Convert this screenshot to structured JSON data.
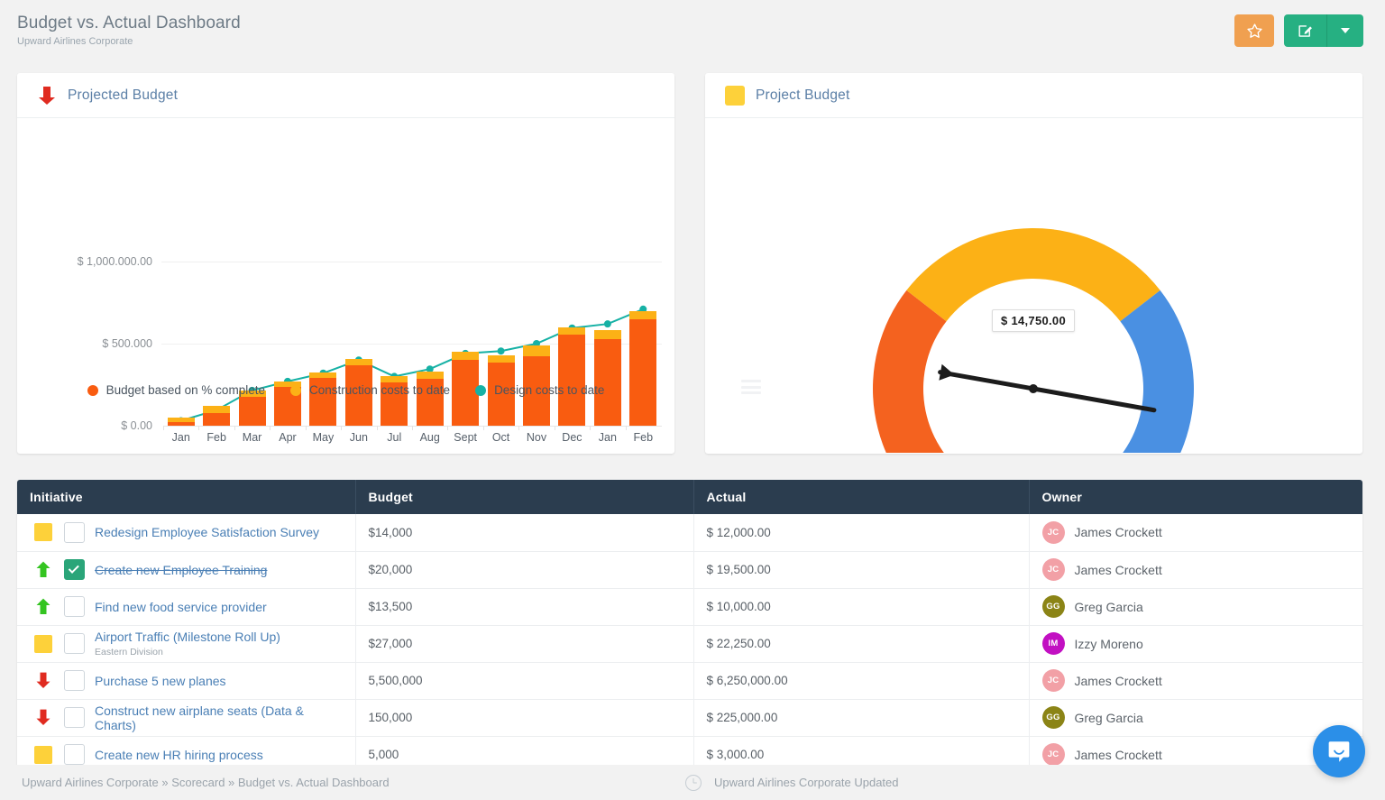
{
  "header": {
    "title": "Budget vs. Actual Dashboard",
    "subtitle": "Upward Airlines Corporate",
    "star_label": "",
    "edit_label": "",
    "caret_label": ""
  },
  "chart_panel": {
    "title": "Projected Budget",
    "icon": "arrow-down-red-icon"
  },
  "gauge_panel": {
    "title": "Project Budget",
    "icon": "square-yellow-icon",
    "value_label": "$ 14,750.00"
  },
  "chart_data": {
    "type": "bar",
    "title": "Projected Budget",
    "xlabel": "",
    "ylabel": "",
    "ylim": [
      0,
      1000000
    ],
    "ytick_labels": [
      "$ 1,000.000.00",
      "$ 500.000",
      "$ 0.00"
    ],
    "ytick_values": [
      1000000,
      500000,
      0
    ],
    "grid": true,
    "legend_position": "bottom",
    "categories": [
      "Jan",
      "Feb",
      "Mar",
      "Apr",
      "May",
      "Jun",
      "Jul",
      "Aug",
      "Sept",
      "Oct",
      "Nov",
      "Dec",
      "Jan",
      "Feb"
    ],
    "series": [
      {
        "name": "Budget based on % complete",
        "color": "#f95c10",
        "values": [
          20000,
          75000,
          175000,
          235000,
          290000,
          370000,
          265000,
          285000,
          400000,
          385000,
          425000,
          555000,
          530000,
          650000
        ]
      },
      {
        "name": "Construction costs to date",
        "color": "#fcb116",
        "values": [
          30000,
          45000,
          40000,
          35000,
          35000,
          35000,
          35000,
          45000,
          50000,
          45000,
          65000,
          45000,
          50000,
          50000
        ]
      },
      {
        "name": "Design costs to date",
        "color": "#16b1a5",
        "type": "line",
        "values": [
          30000,
          95000,
          215000,
          270000,
          320000,
          400000,
          300000,
          345000,
          440000,
          455000,
          500000,
          595000,
          620000,
          710000
        ]
      }
    ]
  },
  "gauge_data": {
    "type": "gauge",
    "value_label": "$ 14,750.00",
    "segments": [
      {
        "name": "low",
        "color": "#f4621f",
        "share": 0.32
      },
      {
        "name": "mid",
        "color": "#fcb116",
        "share": 0.36
      },
      {
        "name": "high",
        "color": "#4a90e2",
        "share": 0.32
      }
    ],
    "needle_color": "#1c1c1c"
  },
  "table": {
    "columns": [
      "Initiative",
      "Budget",
      "Actual",
      "Owner"
    ],
    "rows": [
      {
        "status": "square-yellow",
        "checked": false,
        "done": false,
        "name": "Redesign Employee Satisfaction Survey",
        "sub": "",
        "budget": "$14,000",
        "actual": "$ 12,000.00",
        "owner": "James Crockett",
        "initials": "JC",
        "avatar_color": "#f2a0a6"
      },
      {
        "status": "arrow-up-green",
        "checked": true,
        "done": true,
        "name": "Create new Employee Training",
        "sub": "",
        "budget": "$20,000",
        "actual": "$ 19,500.00",
        "owner": "James Crockett",
        "initials": "JC",
        "avatar_color": "#f2a0a6"
      },
      {
        "status": "arrow-up-green",
        "checked": false,
        "done": false,
        "name": "Find new food service provider",
        "sub": "",
        "budget": "$13,500",
        "actual": "$ 10,000.00",
        "owner": "Greg Garcia",
        "initials": "GG",
        "avatar_color": "#8b8416"
      },
      {
        "status": "square-yellow",
        "checked": false,
        "done": false,
        "name": "Airport Traffic (Milestone Roll Up)",
        "sub": "Eastern Division",
        "budget": "$27,000",
        "actual": "$ 22,250.00",
        "owner": "Izzy Moreno",
        "initials": "IM",
        "avatar_color": "#c210c2"
      },
      {
        "status": "arrow-down-red",
        "checked": false,
        "done": false,
        "name": "Purchase 5 new planes",
        "sub": "",
        "budget": "5,500,000",
        "actual": "$ 6,250,000.00",
        "owner": "James Crockett",
        "initials": "JC",
        "avatar_color": "#f2a0a6"
      },
      {
        "status": "arrow-down-red",
        "checked": false,
        "done": false,
        "name": "Construct new airplane seats (Data & Charts)",
        "sub": "",
        "budget": "150,000",
        "actual": "$ 225,000.00",
        "owner": "Greg Garcia",
        "initials": "GG",
        "avatar_color": "#8b8416"
      },
      {
        "status": "square-yellow",
        "checked": false,
        "done": false,
        "name": "Create new HR hiring process",
        "sub": "",
        "budget": "5,000",
        "actual": "$ 3,000.00",
        "owner": "James Crockett",
        "initials": "JC",
        "avatar_color": "#f2a0a6"
      }
    ]
  },
  "footer": {
    "breadcrumb": "Upward Airlines Corporate » Scorecard » Budget vs. Actual Dashboard",
    "status_text": "Upward Airlines Corporate Updated"
  }
}
